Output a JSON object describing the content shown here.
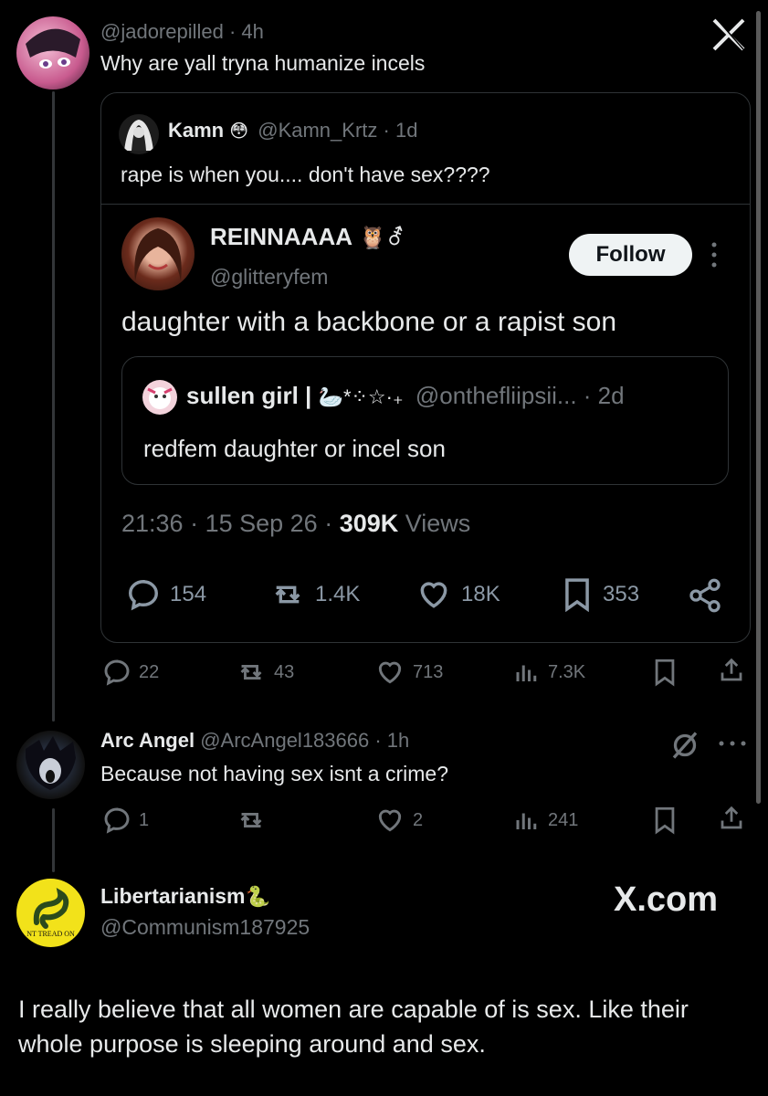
{
  "post1": {
    "handle": "@jadorepilled",
    "time": "4h",
    "text": "Why are yall tryna humanize incels"
  },
  "quote1": {
    "name": "Kamn",
    "emoji": "😳",
    "handle": "@Kamn_Krtz",
    "time": "1d",
    "text": "rape is when you.... don't have sex????"
  },
  "embed": {
    "name": "REINNAAAA",
    "emojis": "🦉⚦",
    "handle": "@glitteryfem",
    "follow_label": "Follow",
    "text": "daughter with a backbone or a rapist son",
    "meta_time": "21:36",
    "meta_date": "15 Sep 26",
    "meta_views": "309K",
    "meta_views_label": "Views",
    "stats": {
      "replies": "154",
      "reposts": "1.4K",
      "likes": "18K",
      "bookmarks": "353"
    }
  },
  "quote2": {
    "name": "sullen girl |",
    "emojis": "🦢*⁘☆·₊",
    "handle": "@onthefliipsii...",
    "time": "2d",
    "text": "redfem daughter or incel son"
  },
  "post1_stats": {
    "replies": "22",
    "reposts": "43",
    "likes": "713",
    "views": "7.3K"
  },
  "post2": {
    "name": "Arc Angel",
    "handle": "@ArcAngel183666",
    "time": "1h",
    "text": "Because not having sex isnt a crime?",
    "stats": {
      "replies": "1",
      "reposts": "",
      "likes": "2",
      "views": "241"
    }
  },
  "post3": {
    "name": "Libertarianism",
    "emoji": "🐍",
    "handle": "@Communism187925",
    "text": "I really believe that all women are capable of is sex. Like their whole purpose is sleeping around and sex.",
    "avatar_text": "NT TREAD ON"
  },
  "watermark": "X.com",
  "close_glyph": "X",
  "colors": {
    "bg": "#000000",
    "text": "#e7e9ea",
    "muted": "#71767b",
    "border": "#2f3336",
    "follow_bg": "#eff3f4"
  }
}
